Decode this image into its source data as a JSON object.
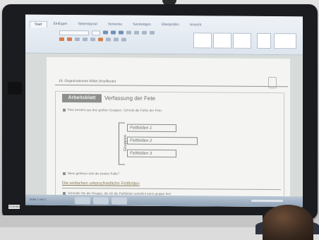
{
  "ribbon": {
    "tabs": [
      "Start",
      "Einfügen",
      "Seitenlayout",
      "Verweise",
      "Sendungen",
      "Überprüfen",
      "Ansicht"
    ],
    "active_tab": "Start"
  },
  "document": {
    "header_text": "19. Organisationen bildet (Kaufleute)",
    "badge_label": "Arbeitsblatt",
    "title": "Verfassung der Fete",
    "task1": "Fete besteht aus drei großen Gruppen. Schreib die Farbe der Fete.",
    "group_label": "Gruppen",
    "boxes": [
      "Feltfelden 1",
      "Feltfelden 2",
      "Feltfelden 3"
    ],
    "task2": "Wem gehören sich die beiden Falle?",
    "section_title": "Die einfachen unterschiedliche Feltfelden",
    "task3": "Schreibe Sie die Gruppe, die ich die Feltfelden verteilen kann gruppe fest."
  },
  "statusbar": {
    "page_info": "Seite 1 von 1"
  },
  "sticker": "TOSHIBA"
}
